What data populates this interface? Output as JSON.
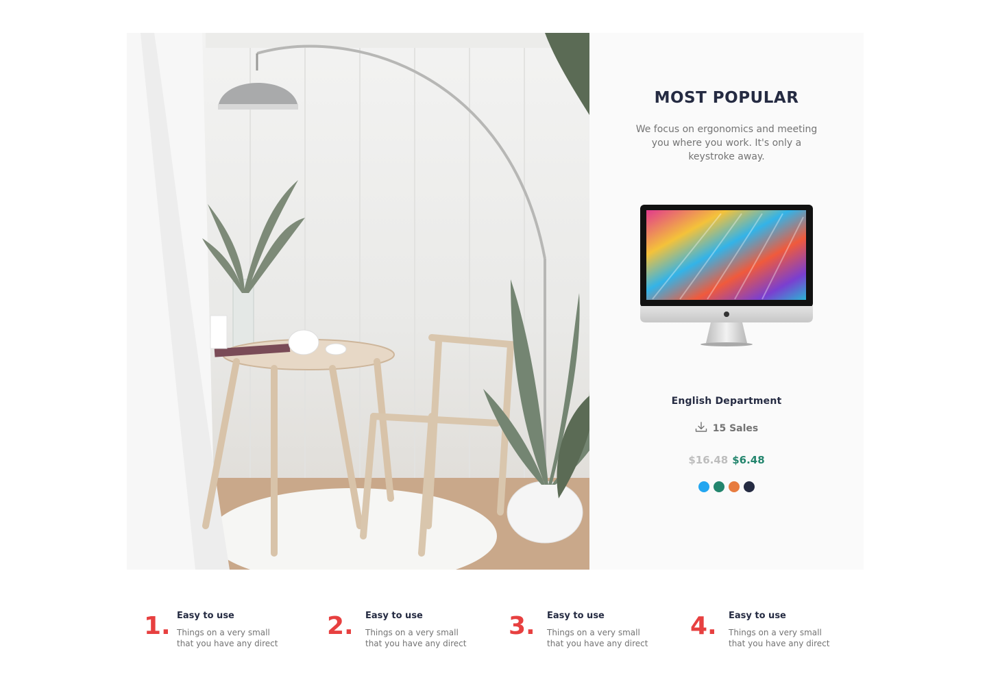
{
  "hero": {
    "image_alt": "interior-photo",
    "panel": {
      "title": "MOST POPULAR",
      "description": "We focus on ergonomics and meeting you where you work. It's only a keystroke away.",
      "product_image": "imac-monitor",
      "department": "English Department",
      "sales_icon": "download-icon",
      "sales_text": "15 Sales",
      "old_price": "$16.48",
      "new_price": "$6.48",
      "colors": [
        "#23a6f0",
        "#23856d",
        "#e77c40",
        "#252b42"
      ]
    }
  },
  "features": [
    {
      "number": "1.",
      "title": "Easy to use",
      "description": "Things on a very  small\nthat you have any direct"
    },
    {
      "number": "2.",
      "title": "Easy to use",
      "description": "Things on a very  small\nthat you have any direct"
    },
    {
      "number": "3.",
      "title": "Easy to use",
      "description": "Things on a very  small\nthat you have any direct"
    },
    {
      "number": "4.",
      "title": "Easy to use",
      "description": "Things on a very  small\nthat you have any direct"
    }
  ]
}
